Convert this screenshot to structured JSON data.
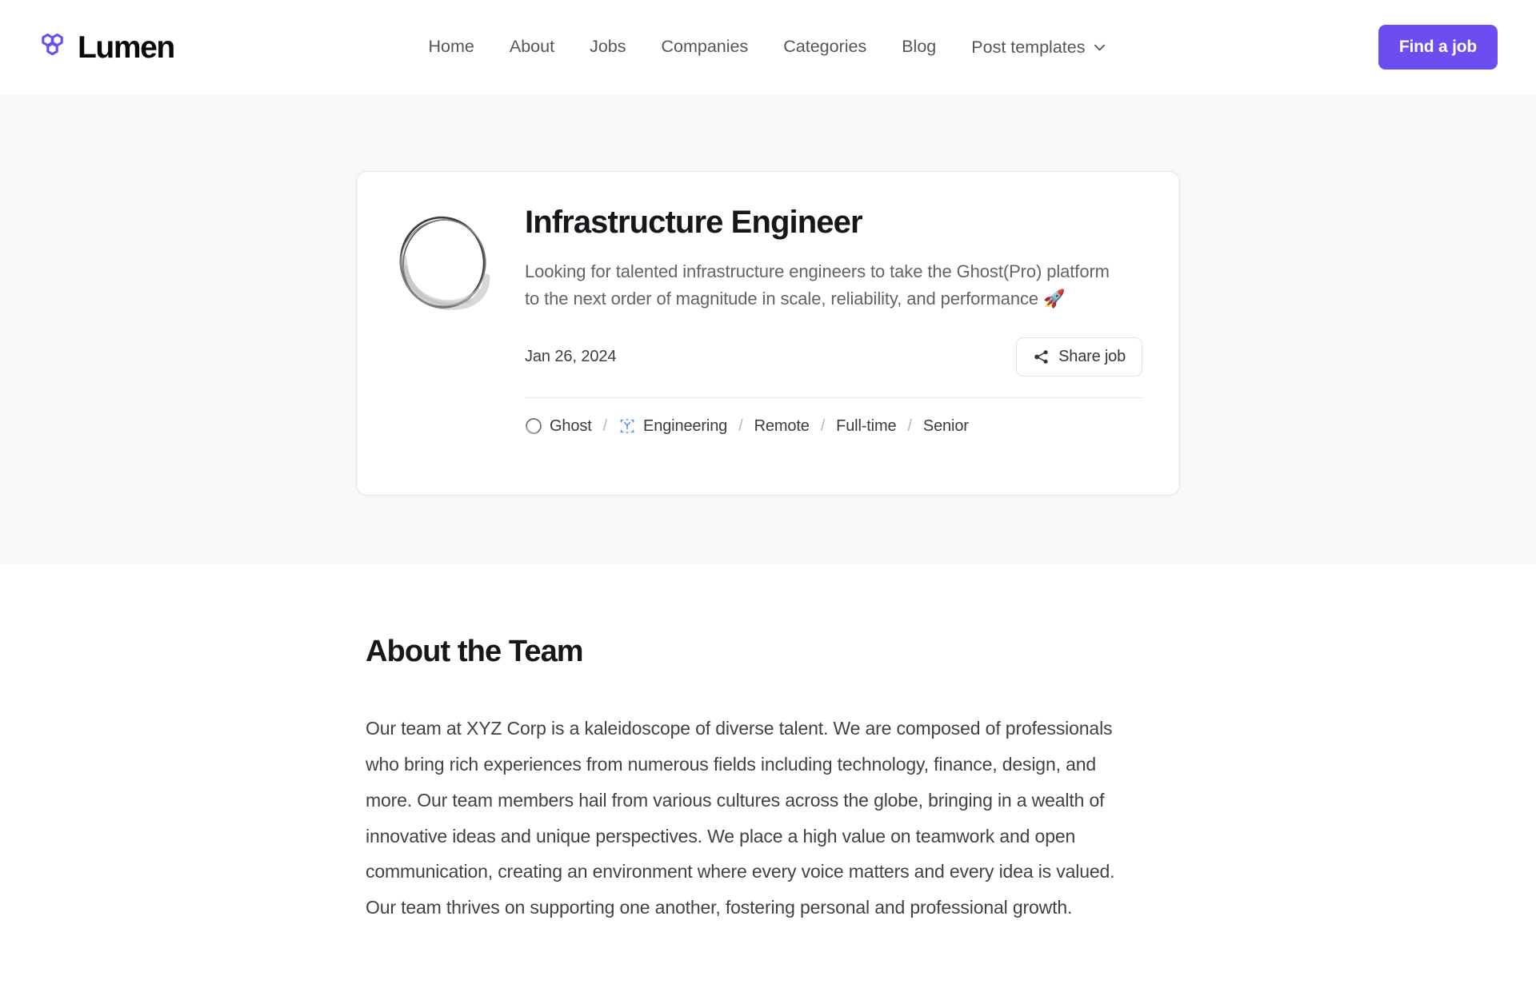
{
  "header": {
    "logo": {
      "icon": "hexagon-cluster-logo-icon",
      "brand_name": "Lumen",
      "color": "#6c4ef0"
    },
    "nav_items": [
      {
        "label": "Home",
        "name": "nav-home"
      },
      {
        "label": "About",
        "name": "nav-about"
      },
      {
        "label": "Jobs",
        "name": "nav-jobs"
      },
      {
        "label": "Companies",
        "name": "nav-companies"
      },
      {
        "label": "Categories",
        "name": "nav-categories"
      },
      {
        "label": "Blog",
        "name": "nav-blog"
      }
    ],
    "dropdown": {
      "label": "Post templates",
      "icon": "chevron-down-icon"
    },
    "cta": {
      "label": "Find a job",
      "bg_color": "#6c4ef0",
      "text_color": "#ffffff"
    }
  },
  "hero": {
    "background_color": "#f8f8f8",
    "job_card": {
      "logo_alt": "ghost-sketch-circle-logo",
      "title": "Infrastructure Engineer",
      "description": "Looking for talented infrastructure engineers to take the Ghost(Pro) platform to the next order of magnitude in scale, reliability, and performance 🚀",
      "date": "Jan 26, 2024",
      "share_button": {
        "label": "Share job",
        "icon": "share-nodes-icon"
      },
      "tags": [
        {
          "label": "Ghost",
          "icon": "ghost-circle-icon"
        },
        {
          "label": "Engineering",
          "icon": "engineering-blue-icon"
        },
        {
          "label": "Remote",
          "icon": null
        },
        {
          "label": "Full-time",
          "icon": null
        },
        {
          "label": "Senior",
          "icon": null
        }
      ],
      "tag_separator": "/"
    }
  },
  "article": {
    "heading": "About the Team",
    "body": "Our team at XYZ Corp is a kaleidoscope of diverse talent. We are composed of professionals who bring rich experiences from numerous fields including technology, finance, design, and more. Our team members hail from various cultures across the globe, bringing in a wealth of innovative ideas and unique perspectives. We place a high value on teamwork and open communication, creating an environment where every voice matters and every idea is valued. Our team thrives on supporting one another, fostering personal and professional growth."
  }
}
